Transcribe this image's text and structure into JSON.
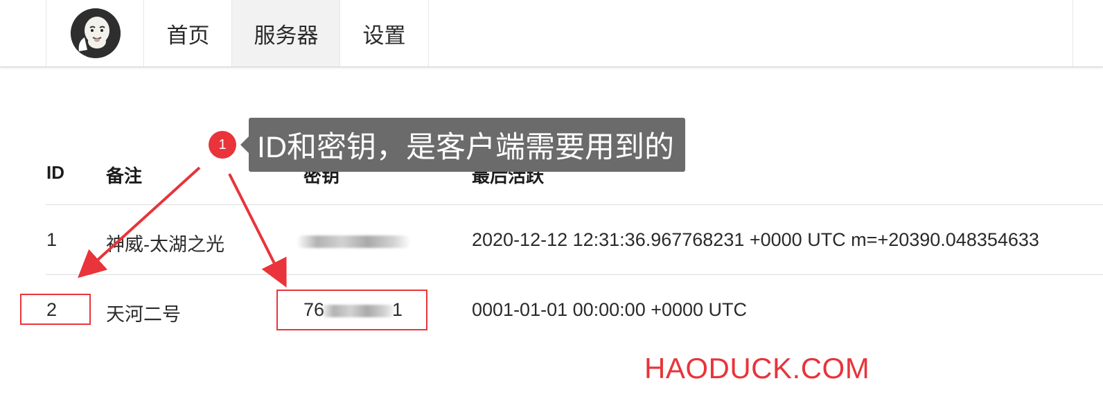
{
  "nav": {
    "items": [
      {
        "label": "首页"
      },
      {
        "label": "服务器"
      },
      {
        "label": "设置"
      }
    ]
  },
  "table": {
    "headers": [
      "ID",
      "备注",
      "密钥",
      "最后活跃"
    ],
    "rows": [
      {
        "id": "1",
        "note": "神威-太湖之光",
        "key_visible": "",
        "last_active": "2020-12-12 12:31:36.967768231 +0000 UTC m=+20390.048354633"
      },
      {
        "id": "2",
        "note": "天河二号",
        "key_prefix": "76",
        "key_suffix": "1",
        "last_active": "0001-01-01 00:00:00 +0000 UTC"
      }
    ]
  },
  "annotation": {
    "badge": "1",
    "tooltip": "ID和密钥，是客户端需要用到的",
    "color": "#e8343a"
  },
  "watermark": "HAODUCK.COM",
  "colors": {
    "accent": "#e8343a",
    "tooltip_bg": "#6b6b6b",
    "active_nav_bg": "#f2f2f2"
  }
}
